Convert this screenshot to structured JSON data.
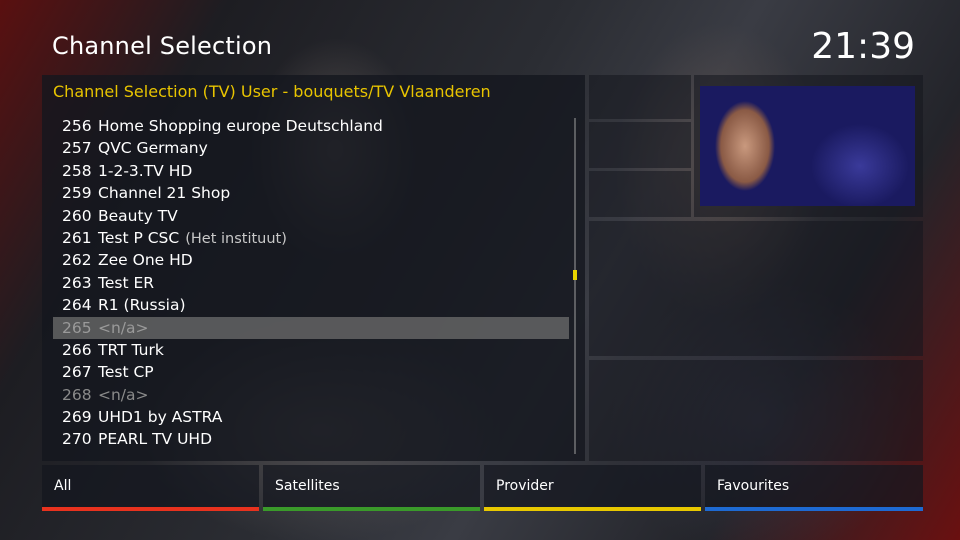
{
  "header": {
    "title": "Channel Selection",
    "clock": "21:39"
  },
  "list": {
    "path": "Channel Selection (TV) User - bouquets/TV Vlaanderen",
    "selected_index": 9,
    "channels": [
      {
        "num": "256",
        "name": "Home Shopping europe Deutschland",
        "provider": ""
      },
      {
        "num": "257",
        "name": "QVC Germany",
        "provider": ""
      },
      {
        "num": "258",
        "name": "1-2-3.TV HD",
        "provider": ""
      },
      {
        "num": "259",
        "name": "Channel 21 Shop",
        "provider": ""
      },
      {
        "num": "260",
        "name": "Beauty TV",
        "provider": ""
      },
      {
        "num": "261",
        "name": "Test P CSC",
        "provider": "(Het instituut)"
      },
      {
        "num": "262",
        "name": "Zee One HD",
        "provider": ""
      },
      {
        "num": "263",
        "name": "Test ER",
        "provider": ""
      },
      {
        "num": "264",
        "name": "R1 (Russia)",
        "provider": ""
      },
      {
        "num": "265",
        "name": "<n/a>",
        "provider": ""
      },
      {
        "num": "266",
        "name": "TRT Turk",
        "provider": ""
      },
      {
        "num": "267",
        "name": "Test CP",
        "provider": ""
      },
      {
        "num": "268",
        "name": "<n/a>",
        "provider": ""
      },
      {
        "num": "269",
        "name": "UHD1 by ASTRA",
        "provider": ""
      },
      {
        "num": "270",
        "name": "PEARL TV UHD",
        "provider": ""
      }
    ]
  },
  "buttons": {
    "red": {
      "label": "All",
      "color": "#e8321e"
    },
    "green": {
      "label": "Satellites",
      "color": "#3a9a2a"
    },
    "yellow": {
      "label": "Provider",
      "color": "#e8c800"
    },
    "blue": {
      "label": "Favourites",
      "color": "#1e6ad2"
    }
  },
  "colors": {
    "path_text": "#e8c400",
    "scroll_thumb": "#e8d400"
  }
}
